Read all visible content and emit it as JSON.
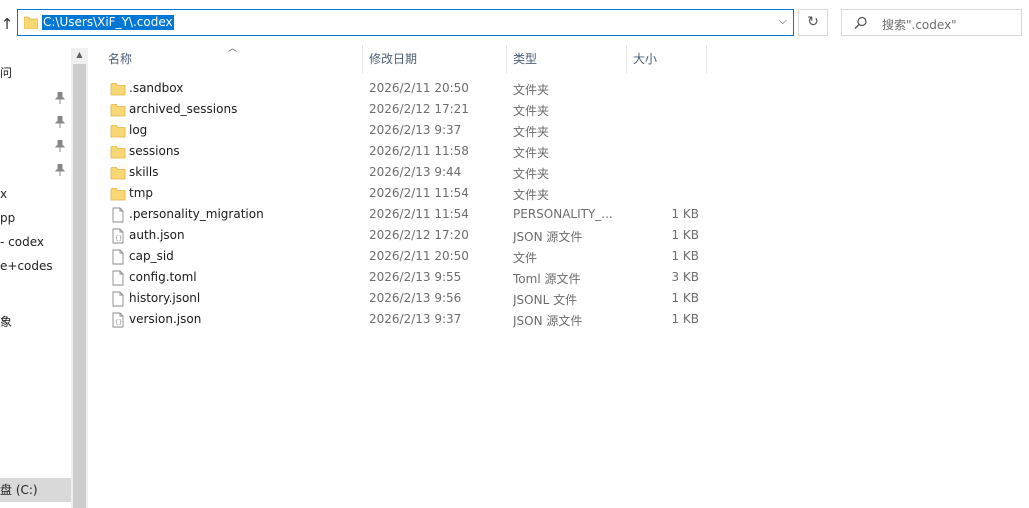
{
  "address_bar": {
    "path": "C:\\Users\\XiF_Y\\.codex"
  },
  "search": {
    "placeholder": "搜索\".codex\""
  },
  "nav": {
    "items": [
      {
        "label": "问",
        "pinned": false
      },
      {
        "label": "",
        "pinned": true
      },
      {
        "label": "",
        "pinned": true
      },
      {
        "label": "",
        "pinned": true
      },
      {
        "label": "",
        "pinned": true
      },
      {
        "label": "x",
        "pinned": false
      },
      {
        "label": "pp",
        "pinned": false
      },
      {
        "label": "- codex",
        "pinned": false
      },
      {
        "label": "e+codes",
        "pinned": false
      },
      {
        "label": "象",
        "pinned": false
      },
      {
        "label": "盘 (C:)",
        "pinned": false,
        "selected": true
      }
    ]
  },
  "columns": {
    "name": "名称",
    "date": "修改日期",
    "type": "类型",
    "size": "大小"
  },
  "files": [
    {
      "name": ".sandbox",
      "date": "2026/2/11 20:50",
      "type": "文件夹",
      "size": "",
      "kind": "folder"
    },
    {
      "name": "archived_sessions",
      "date": "2026/2/12 17:21",
      "type": "文件夹",
      "size": "",
      "kind": "folder"
    },
    {
      "name": "log",
      "date": "2026/2/13 9:37",
      "type": "文件夹",
      "size": "",
      "kind": "folder"
    },
    {
      "name": "sessions",
      "date": "2026/2/11 11:58",
      "type": "文件夹",
      "size": "",
      "kind": "folder"
    },
    {
      "name": "skills",
      "date": "2026/2/13 9:44",
      "type": "文件夹",
      "size": "",
      "kind": "folder"
    },
    {
      "name": "tmp",
      "date": "2026/2/11 11:54",
      "type": "文件夹",
      "size": "",
      "kind": "folder"
    },
    {
      "name": ".personality_migration",
      "date": "2026/2/11 11:54",
      "type": "PERSONALITY_...",
      "size": "1 KB",
      "kind": "file"
    },
    {
      "name": "auth.json",
      "date": "2026/2/12 17:20",
      "type": "JSON 源文件",
      "size": "1 KB",
      "kind": "json"
    },
    {
      "name": "cap_sid",
      "date": "2026/2/11 20:50",
      "type": "文件",
      "size": "1 KB",
      "kind": "file"
    },
    {
      "name": "config.toml",
      "date": "2026/2/13 9:55",
      "type": "Toml 源文件",
      "size": "3 KB",
      "kind": "file"
    },
    {
      "name": "history.jsonl",
      "date": "2026/2/13 9:56",
      "type": "JSONL 文件",
      "size": "1 KB",
      "kind": "file"
    },
    {
      "name": "version.json",
      "date": "2026/2/13 9:37",
      "type": "JSON 源文件",
      "size": "1 KB",
      "kind": "json"
    }
  ],
  "colors": {
    "accent": "#0078d7",
    "folder": "#f8d775",
    "header_text": "#4c607a"
  }
}
